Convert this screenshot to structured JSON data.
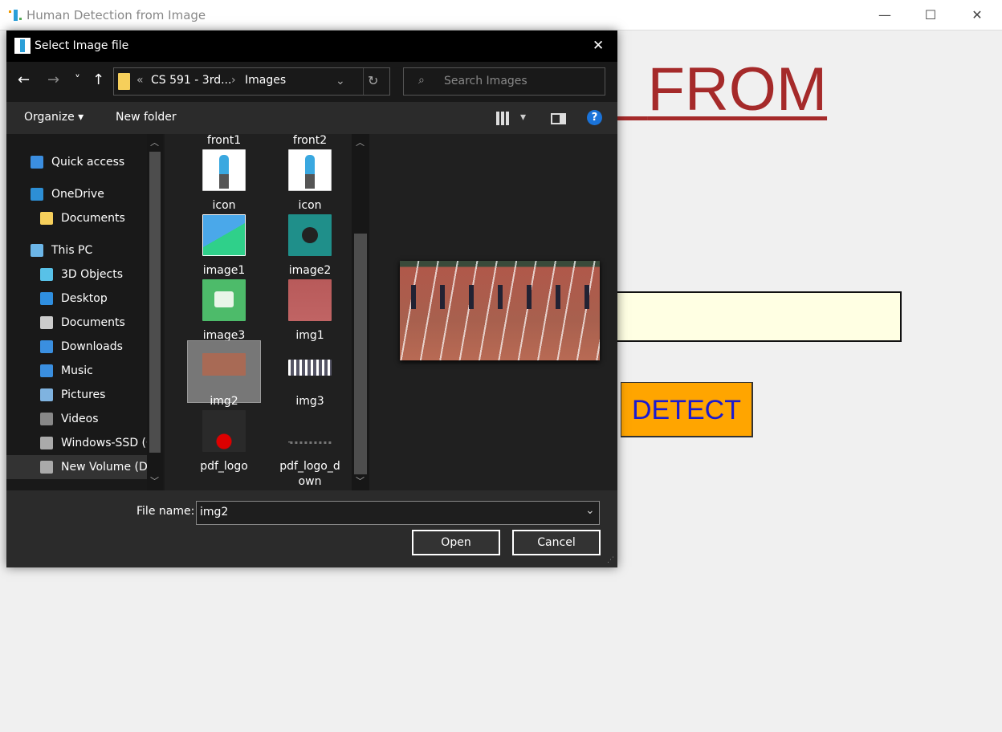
{
  "app": {
    "title": "Human Detection from Image",
    "heading_visible": "FROM",
    "detect_label": "DETECT",
    "path_value": "",
    "colors": {
      "heading": "#a52a2a",
      "detect_bg": "#ffa500",
      "detect_text": "#1a1ad0",
      "path_bg": "#ffffe3"
    }
  },
  "window_controls": {
    "minimize": "—",
    "maximize": "☐",
    "close": "✕"
  },
  "dialog": {
    "title": "Select Image file",
    "close": "✕",
    "nav": {
      "back": "←",
      "forward": "→",
      "recent": "˅",
      "up": "↑",
      "refresh": "↻",
      "breadcrumb_prefix": "«",
      "breadcrumb": [
        "CS 591 - 3rd...",
        "Images"
      ],
      "separator": "›",
      "search_placeholder": "Search Images"
    },
    "toolbar": {
      "organize": "Organize",
      "new_folder": "New folder",
      "help": "?"
    },
    "sidebar": [
      {
        "label": "Quick access",
        "icon": "star-icon",
        "color": "#3b8ee0"
      },
      {
        "label": "OneDrive",
        "icon": "cloud-icon",
        "color": "#2d8fd5"
      },
      {
        "label": "Documents",
        "icon": "folder-icon",
        "color": "#f6cf5b"
      },
      {
        "label": "This PC",
        "icon": "computer-icon",
        "color": "#6cb6e8"
      },
      {
        "label": "3D Objects",
        "icon": "cube-icon",
        "color": "#58c1e8"
      },
      {
        "label": "Desktop",
        "icon": "desktop-icon",
        "color": "#2f8fe0"
      },
      {
        "label": "Documents",
        "icon": "document-icon",
        "color": "#ccc"
      },
      {
        "label": "Downloads",
        "icon": "download-icon",
        "color": "#3a8fe0"
      },
      {
        "label": "Music",
        "icon": "music-icon",
        "color": "#3a8fe0"
      },
      {
        "label": "Pictures",
        "icon": "pictures-icon",
        "color": "#7fb3e0"
      },
      {
        "label": "Videos",
        "icon": "videos-icon",
        "color": "#888"
      },
      {
        "label": "Windows-SSD (C",
        "icon": "drive-icon",
        "color": "#aaa"
      },
      {
        "label": "New Volume (D:",
        "icon": "drive-icon",
        "color": "#aaa",
        "selected": true
      }
    ],
    "files": [
      {
        "label": "front1"
      },
      {
        "label": "front2"
      },
      {
        "label": "icon",
        "thumb": "person-icon"
      },
      {
        "label": "icon",
        "thumb": "person-icon"
      },
      {
        "label": "image1",
        "thumb": "landscape-icon"
      },
      {
        "label": "image2",
        "thumb": "video-icon"
      },
      {
        "label": "image3",
        "thumb": "camera-icon"
      },
      {
        "label": "img1",
        "thumb": "runners-photo"
      },
      {
        "label": "img2",
        "thumb": "race-photo",
        "selected": true
      },
      {
        "label": "img3",
        "thumb": "people-photo"
      },
      {
        "label": "pdf_logo",
        "thumb": "group-icon"
      },
      {
        "label": "pdf_logo_d\nown",
        "label_line1": "pdf_logo_d",
        "label_line2": "own",
        "thumb": "text-image"
      }
    ],
    "file_name_label": "File name:",
    "file_name_value": "img2",
    "open": "Open",
    "cancel": "Cancel"
  }
}
